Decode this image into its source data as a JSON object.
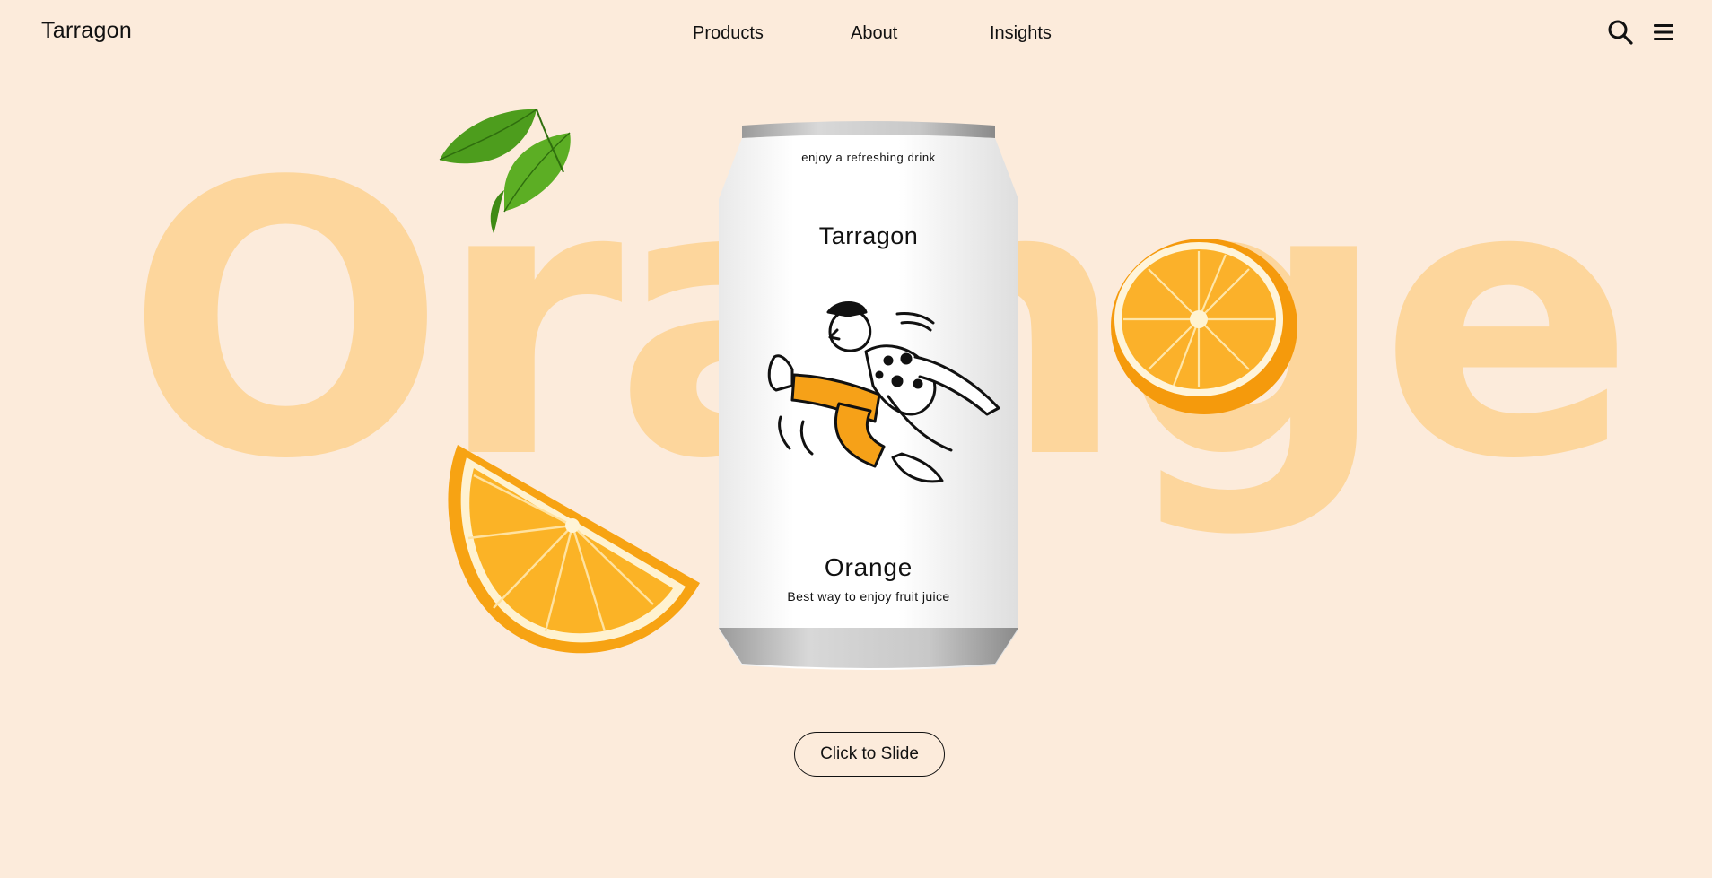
{
  "header": {
    "logo": "Tarragon",
    "nav": [
      {
        "label": "Products"
      },
      {
        "label": "About"
      },
      {
        "label": "Insights"
      }
    ],
    "icons": {
      "search": "search-icon",
      "menu": "menu-icon"
    }
  },
  "hero": {
    "background_word": "Orange",
    "can": {
      "tagline": "enjoy a refreshing drink",
      "brand": "Tarragon",
      "flavor": "Orange",
      "description": "Best way to enjoy fruit juice"
    },
    "cta_label": "Click to Slide"
  },
  "colors": {
    "background": "#fcebdb",
    "background_word": "#fdd69c",
    "accent_orange": "#f9a21b",
    "text": "#111111"
  }
}
